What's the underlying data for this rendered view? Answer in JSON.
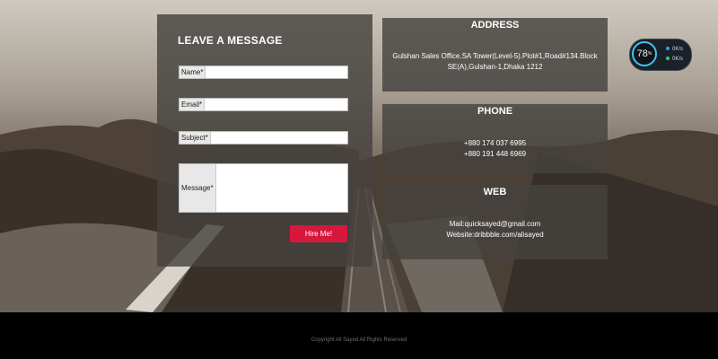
{
  "form": {
    "title": "LEAVE A MESSAGE",
    "fields": {
      "name_label": "Name*",
      "email_label": "Email*",
      "subject_label": "Subject*",
      "message_label": "Message*"
    },
    "submit_label": "Hire Me!"
  },
  "address": {
    "title": "ADDRESS",
    "line1": "Gulshan Sales Office.SA Tower(Level-5).Plot#1,Road#134.Block",
    "line2": "SE(A),Gulshan-1,Dhaka 1212"
  },
  "phone": {
    "title": "PHONE",
    "line1": "+880 174 037 6995",
    "line2": "+880 191 448 6969"
  },
  "web": {
    "title": "WEB",
    "mail": "Mail:quicksayed@gmail.com",
    "website": "Website:dribbble.com/alisayed"
  },
  "widget": {
    "percent": "78",
    "percent_unit": "%",
    "upload": "0K/s",
    "download": "0K/s",
    "colors": {
      "upload_dot": "#3aa0e0",
      "download_dot": "#3fc46a",
      "ring": "#41c2f0"
    }
  },
  "footer": {
    "copyright": "Copyright All Sayed All Rights Reserved"
  },
  "colors": {
    "accent": "#d9173c"
  }
}
